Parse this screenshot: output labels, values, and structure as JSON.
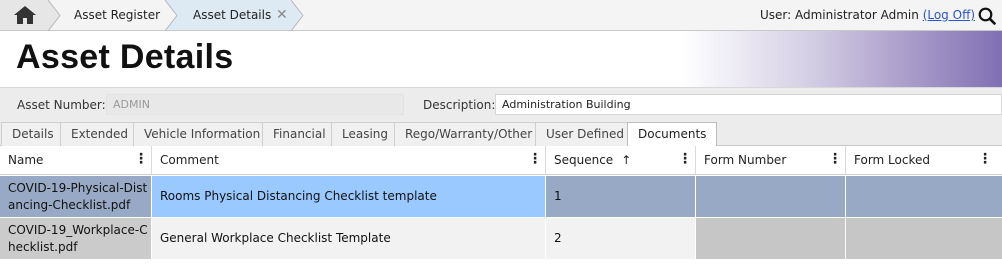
{
  "breadcrumbs": [
    {
      "label": "Asset Register"
    },
    {
      "label": "Asset Details"
    }
  ],
  "user": {
    "prefix": "User: Administrator Admin ",
    "logoff_label": "(Log Off)"
  },
  "page_title": "Asset Details",
  "fields": {
    "asset_number_label": "Asset Number:",
    "asset_number_value": "ADMIN",
    "description_label": "Description:",
    "description_value": "Administration Building"
  },
  "tabs": [
    {
      "label": "Details"
    },
    {
      "label": "Extended"
    },
    {
      "label": "Vehicle Information"
    },
    {
      "label": "Financial"
    },
    {
      "label": "Leasing"
    },
    {
      "label": "Rego/Warranty/Other"
    },
    {
      "label": "User Defined"
    },
    {
      "label": "Documents",
      "active": true
    }
  ],
  "grid": {
    "columns": [
      "Name",
      "Comment",
      "Sequence",
      "Form Number",
      "Form Locked"
    ],
    "sort_indicator": "↑",
    "menu_glyph": "⋮",
    "rows": [
      {
        "name": "COVID-19-Physical-Distancing-Checklist.pdf",
        "comment": "Rooms Physical Distancing Checklist template",
        "sequence": "1",
        "form_number": "",
        "form_locked": "",
        "selected": true
      },
      {
        "name": "COVID-19_Workplace-Checklist.pdf",
        "comment": "General Workplace Checklist Template",
        "sequence": "2",
        "form_number": "",
        "form_locked": "",
        "selected": false
      }
    ]
  },
  "colors": {
    "accent_purple": "#8070b4",
    "active_breadcrumb": "#ddeaf4",
    "selected_row_primary": "#99c9ff",
    "selected_row_other": "#98a9c5",
    "row_name_bg": "#cbcbcb",
    "row_other_bg": "#c6c6c6",
    "row_comment_bg": "#f2f2f2",
    "link": "#2a55c8"
  },
  "icons": {
    "home": "home-icon",
    "search": "search-icon",
    "close": "close-icon"
  }
}
